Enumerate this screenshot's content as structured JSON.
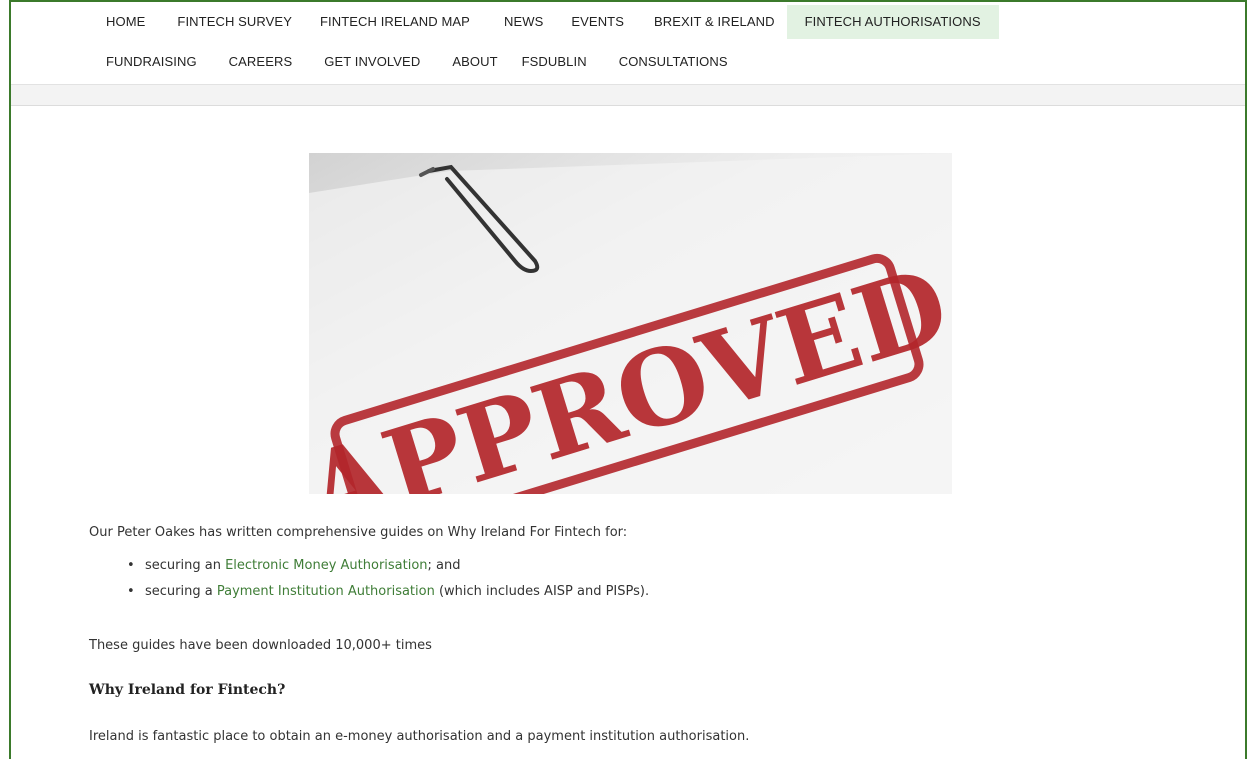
{
  "nav": {
    "row1": [
      "HOME",
      "FINTECH SURVEY",
      "FINTECH IRELAND MAP",
      "NEWS",
      "EVENTS",
      "BREXIT & IRELAND",
      "FINTECH AUTHORISATIONS"
    ],
    "row2": [
      "FUNDRAISING",
      "CAREERS",
      "GET INVOLVED",
      "ABOUT",
      "FSDUBLIN",
      "CONSULTATIONS"
    ],
    "active": "FINTECH AUTHORISATIONS"
  },
  "hero": {
    "stamp_text": "APPROVED",
    "stamp_color": "#b3262b",
    "icon": "paperclip-icon"
  },
  "article": {
    "intro": "Our Peter Oakes has written comprehensive guides on Why Ireland For Fintech for:",
    "bullets": [
      {
        "before": "securing an ",
        "link": "Electronic Money Authorisation",
        "after": "; and"
      },
      {
        "before": "securing a ",
        "link": "Payment Institution Authorisation",
        "after": " (which includes AISP and PISPs)."
      }
    ],
    "downloads": "These guides have been downloaded 10,000+ times",
    "heading": "Why Ireland for Fintech?",
    "paragraph": "Ireland is fantastic place to obtain an e-money authorisation and a payment institution authorisation."
  },
  "colors": {
    "accent": "#3b7a2b",
    "link": "#3f7d37",
    "active_tab_bg": "#e2f2e2"
  }
}
